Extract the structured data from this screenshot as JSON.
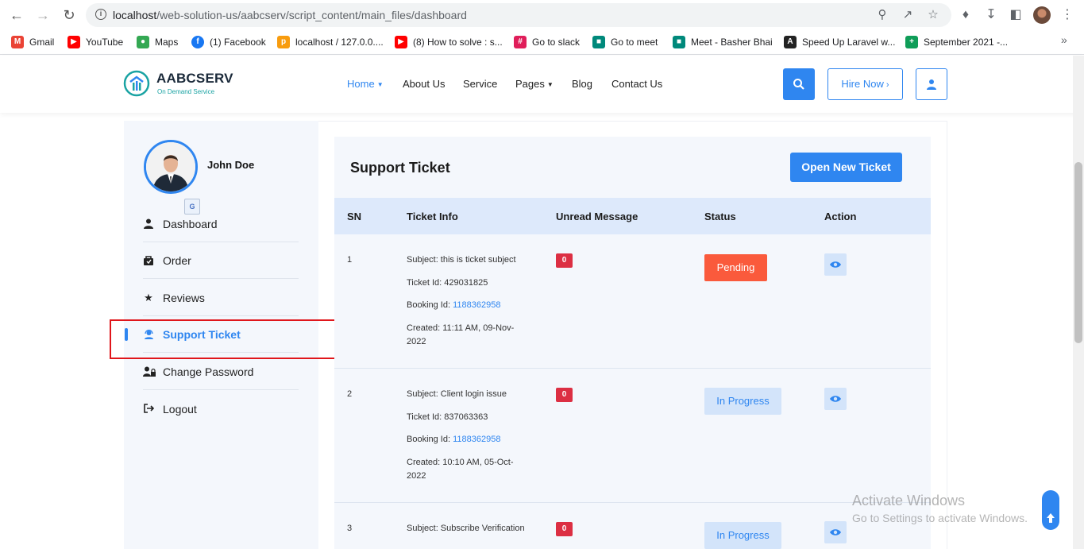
{
  "browser": {
    "url_host": "localhost",
    "url_path": "/web-solution-us/aabcserv/script_content/main_files/dashboard",
    "bookmarks": [
      {
        "label": "Gmail",
        "icon": "gmail-icon",
        "color": "#ea4335"
      },
      {
        "label": "YouTube",
        "icon": "youtube-icon",
        "color": "#ff0000"
      },
      {
        "label": "Maps",
        "icon": "maps-icon",
        "color": "#34a853"
      },
      {
        "label": "(1) Facebook",
        "icon": "facebook-icon",
        "color": "#1877f2"
      },
      {
        "label": "localhost / 127.0.0....",
        "icon": "phpmyadmin-icon",
        "color": "#f89c0e"
      },
      {
        "label": "(8) How to solve : s...",
        "icon": "youtube-icon",
        "color": "#ff0000"
      },
      {
        "label": "Go to slack",
        "icon": "slack-icon",
        "color": "#e01e5a"
      },
      {
        "label": "Go to meet",
        "icon": "google-meet-icon",
        "color": "#00897b"
      },
      {
        "label": "Meet - Basher Bhai",
        "icon": "google-meet-icon",
        "color": "#00897b"
      },
      {
        "label": "Speed Up Laravel w...",
        "icon": "laravel-icon",
        "color": "#222222"
      },
      {
        "label": "September 2021 -...",
        "icon": "sheets-icon",
        "color": "#0f9d58"
      }
    ]
  },
  "header": {
    "brand": "AABCSERV",
    "tagline": "On Demand Service",
    "menu": [
      {
        "label": "Home",
        "active": true,
        "dropdown": true
      },
      {
        "label": "About Us",
        "active": false,
        "dropdown": false
      },
      {
        "label": "Service",
        "active": false,
        "dropdown": false
      },
      {
        "label": "Pages",
        "active": false,
        "dropdown": true
      },
      {
        "label": "Blog",
        "active": false,
        "dropdown": false
      },
      {
        "label": "Contact Us",
        "active": false,
        "dropdown": false
      }
    ],
    "hire_label": "Hire Now",
    "accent_color": "#2f86f0"
  },
  "sidebar": {
    "user_name": "John Doe",
    "items": [
      {
        "label": "Dashboard",
        "icon": "user-icon",
        "active": false
      },
      {
        "label": "Order",
        "icon": "order-bag-icon",
        "active": false
      },
      {
        "label": "Reviews",
        "icon": "star-icon",
        "active": false
      },
      {
        "label": "Support Ticket",
        "icon": "support-agent-icon",
        "active": true
      },
      {
        "label": "Change Password",
        "icon": "user-lock-icon",
        "active": false
      },
      {
        "label": "Logout",
        "icon": "logout-icon",
        "active": false
      }
    ]
  },
  "content": {
    "title": "Support Ticket",
    "open_ticket_label": "Open New Ticket",
    "columns": [
      "SN",
      "Ticket Info",
      "Unread Message",
      "Status",
      "Action"
    ],
    "rows": [
      {
        "sn": "1",
        "subject": "Subject: this is ticket subject",
        "ticket_id": "Ticket Id: 429031825",
        "booking_label": "Booking Id: ",
        "booking_id": "1188362958",
        "created_line1": "Created: 11:11 AM, 09-Nov-",
        "created_line2": "2022",
        "unread": "0",
        "status": "Pending"
      },
      {
        "sn": "2",
        "subject": "Subject: Client login issue",
        "ticket_id": "Ticket Id: 837063363",
        "booking_label": "Booking Id: ",
        "booking_id": "1188362958",
        "created_line1": "Created: 10:10 AM, 05-Oct-",
        "created_line2": "2022",
        "unread": "0",
        "status": "In Progress"
      },
      {
        "sn": "3",
        "subject": "Subject: Subscribe Verification",
        "unread": "0",
        "status": "In Progress"
      }
    ]
  },
  "overlay": {
    "watermark_title": "Activate Windows",
    "watermark_sub": "Go to Settings to activate Windows."
  }
}
